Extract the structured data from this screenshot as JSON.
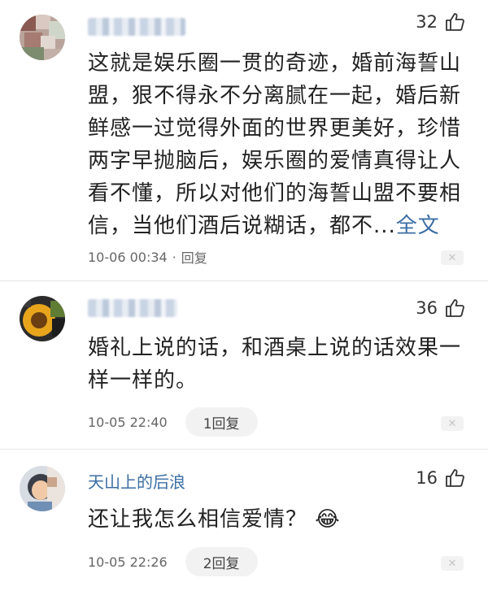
{
  "comments": [
    {
      "username": "",
      "likes": "32",
      "text": "这就是娱乐圈一贯的奇迹，婚前海誓山盟，狠不得永不分离腻在一起，婚后新鲜感一过觉得外面的世界更美好，珍惜两字早抛脑后，娱乐圈的爱情真得让人看不懂，所以对他们的海誓山盟不要相信，当他们酒后说糊话，都不...",
      "more_label": "全文",
      "time": "10-06 00:34",
      "reply_label": "回复"
    },
    {
      "username": "",
      "likes": "36",
      "text": "婚礼上说的话，和酒桌上说的话效果一样一样的。",
      "time": "10-05 22:40",
      "reply_label": "1回复"
    },
    {
      "username": "天山上的后浪",
      "likes": "16",
      "text": "还让我怎么相信爱情？",
      "emoji": "😂",
      "time": "10-05 22:26",
      "reply_label": "2回复"
    }
  ],
  "icons": {
    "like": "thumb-up-icon",
    "close": "close-icon"
  },
  "colors": {
    "link": "#3a6ea5",
    "text": "#222222",
    "meta": "#666666",
    "pill_bg": "#f2f2f2"
  }
}
